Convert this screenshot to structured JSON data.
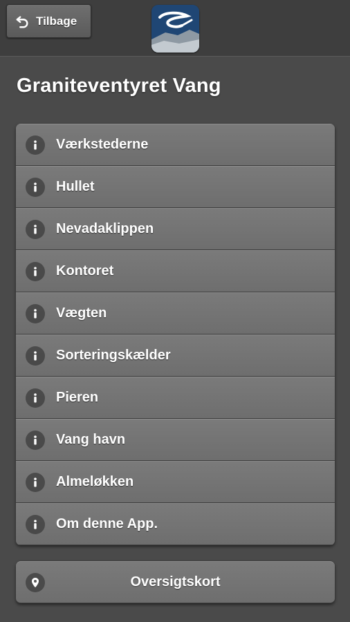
{
  "header": {
    "back_label": "Tilbage",
    "back_icon": "back-arrow-icon",
    "logo_icon": "app-logo"
  },
  "page": {
    "title": "Graniteventyret Vang"
  },
  "menu": {
    "icon": "info-icon",
    "items": [
      {
        "label": "Værkstederne"
      },
      {
        "label": "Hullet"
      },
      {
        "label": "Nevadaklippen"
      },
      {
        "label": "Kontoret"
      },
      {
        "label": "Vægten"
      },
      {
        "label": "Sorteringskælder"
      },
      {
        "label": "Pieren"
      },
      {
        "label": "Vang havn"
      },
      {
        "label": "Almeløkken"
      },
      {
        "label": "Om denne App."
      }
    ]
  },
  "map_button": {
    "label": "Oversigtskort",
    "icon": "location-pin-icon"
  },
  "colors": {
    "background": "#4a4a4a",
    "header": "#3e3e3e",
    "button": "#747474",
    "text": "#ffffff"
  }
}
